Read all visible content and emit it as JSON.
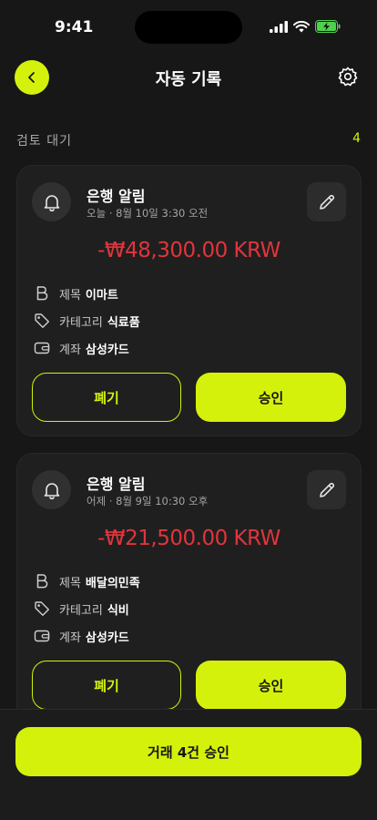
{
  "status": {
    "time": "9:41"
  },
  "header": {
    "title": "자동 기록",
    "back_icon": "chevron-left-icon",
    "settings_icon": "gear-icon"
  },
  "section": {
    "label": "검토 대기",
    "count": "4"
  },
  "colors": {
    "accent": "#d4f10c",
    "negative": "#e0353b",
    "background": "#171717",
    "card": "#1f1f1f"
  },
  "cards": [
    {
      "title": "은행 알림",
      "time": "오늘 · 8월 10일 3:30 오전",
      "amount": "-₩48,300.00 KRW",
      "rows": [
        {
          "label": "제목",
          "value": "이마트",
          "icon": "bold-b-icon"
        },
        {
          "label": "카테고리",
          "value": "식료품",
          "icon": "tag-icon"
        },
        {
          "label": "계좌",
          "value": "삼성카드",
          "icon": "wallet-icon"
        }
      ],
      "discard_label": "폐기",
      "approve_label": "승인"
    },
    {
      "title": "은행 알림",
      "time": "어제 · 8월 9일 10:30 오후",
      "amount": "-₩21,500.00 KRW",
      "rows": [
        {
          "label": "제목",
          "value": "배달의민족",
          "icon": "bold-b-icon"
        },
        {
          "label": "카테고리",
          "value": "식비",
          "icon": "tag-icon"
        },
        {
          "label": "계좌",
          "value": "삼성카드",
          "icon": "wallet-icon"
        }
      ],
      "discard_label": "폐기",
      "approve_label": "승인"
    }
  ],
  "footer": {
    "bulk_label": "거래 4건 승인"
  }
}
